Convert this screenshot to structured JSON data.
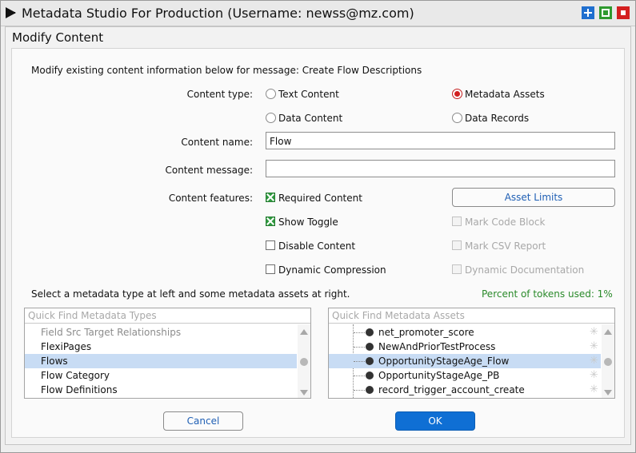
{
  "window": {
    "title": "Metadata Studio For Production (Username: newss@mz.com)",
    "controls": [
      "plus-icon",
      "maximize-icon",
      "stop-icon"
    ]
  },
  "dialog": {
    "title": "Modify Content",
    "intro": "Modify existing content information below for message: Create Flow Descriptions",
    "content_type": {
      "label": "Content type:",
      "options": [
        {
          "label": "Text Content",
          "selected": false
        },
        {
          "label": "Metadata Assets",
          "selected": true
        },
        {
          "label": "Data Content",
          "selected": false
        },
        {
          "label": "Data Records",
          "selected": false
        }
      ]
    },
    "content_name": {
      "label": "Content name:",
      "value": "Flow"
    },
    "content_message": {
      "label": "Content message:",
      "value": ""
    },
    "content_features": {
      "label": "Content features:",
      "left": [
        {
          "label": "Required Content",
          "checked": true
        },
        {
          "label": "Show Toggle",
          "checked": true
        },
        {
          "label": "Disable Content",
          "checked": false
        },
        {
          "label": "Dynamic Compression",
          "checked": false
        }
      ],
      "asset_limits_button": "Asset Limits",
      "right": [
        {
          "label": "Mark Code Block",
          "checked": false,
          "disabled": true
        },
        {
          "label": "Mark CSV Report",
          "checked": false,
          "disabled": true
        },
        {
          "label": "Dynamic Documentation",
          "checked": false,
          "disabled": true
        }
      ]
    },
    "select_hint": "Select a metadata type at left and some metadata assets at right.",
    "tokens_used": "Percent of tokens used: 1%",
    "types_list": {
      "placeholder": "Quick Find Metadata Types",
      "items": [
        {
          "label": "Field Src Target Relationships",
          "faded": true
        },
        {
          "label": "FlexiPages"
        },
        {
          "label": "Flows",
          "selected": true
        },
        {
          "label": "Flow Category"
        },
        {
          "label": "Flow Definitions"
        }
      ]
    },
    "assets_list": {
      "placeholder": "Quick Find Metadata Assets",
      "items": [
        {
          "label": "net_promoter_score"
        },
        {
          "label": "NewAndPriorTestProcess"
        },
        {
          "label": "OpportunityStageAge_Flow",
          "selected": true
        },
        {
          "label": "OpportunityStageAge_PB"
        },
        {
          "label": "record_trigger_account_create"
        }
      ]
    },
    "cancel_label": "Cancel",
    "ok_label": "OK"
  },
  "colors": {
    "accent": "#0f6fd4",
    "selected_row": "#c8dcf4",
    "radio_selected": "#d22020",
    "checkbox_checked": "#2e9a3e",
    "tokens_text": "#2a8a2a"
  }
}
